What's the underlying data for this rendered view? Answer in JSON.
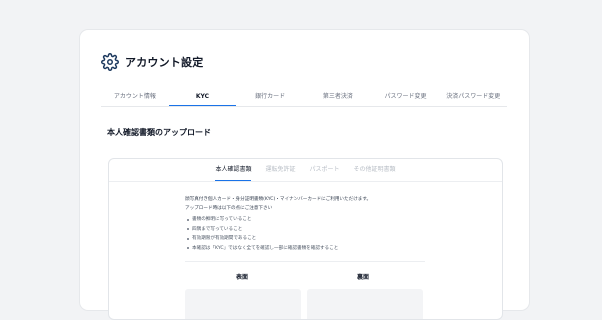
{
  "header": {
    "title": "アカウント設定",
    "icon": "gear-icon"
  },
  "tabs": [
    {
      "label": "アカウント情報",
      "active": false
    },
    {
      "label": "KYC",
      "active": true
    },
    {
      "label": "銀行カード",
      "active": false
    },
    {
      "label": "第三者決済",
      "active": false
    },
    {
      "label": "パスワード変更",
      "active": false
    },
    {
      "label": "決済パスワード変更",
      "active": false
    }
  ],
  "section": {
    "title": "本人確認書類のアップロード"
  },
  "subtabs": [
    {
      "label": "本人確認書類",
      "active": true
    },
    {
      "label": "運転免許証",
      "active": false
    },
    {
      "label": "パスポート",
      "active": false
    },
    {
      "label": "その他証明書類",
      "active": false
    }
  ],
  "instructions": {
    "line1": "顔写真付き個人カード・身分証明書類(KYC)・マイナンバーカードにご利用いただけます。",
    "line2": "アップロード時は以下の点にご注意下さい",
    "bullets": [
      "書類の鮮明に写っていること",
      "四隅まで写っていること",
      "有効期限が有効期間であること",
      "本確認は「KYC」ではなく全てを確認し一部に確認書類を確認すること"
    ]
  },
  "upload": {
    "front_label": "表面",
    "back_label": "裏面"
  },
  "colors": {
    "accent": "#1a73e8",
    "background": "#f2f3f5"
  }
}
